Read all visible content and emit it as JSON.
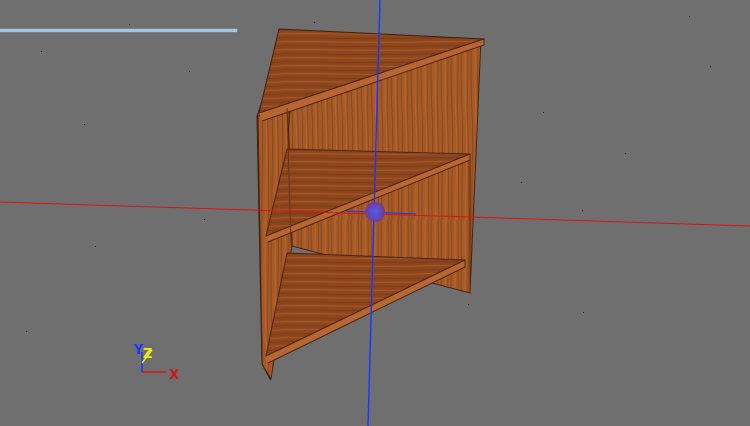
{
  "viewport": {
    "background": "#6f6f6f",
    "tool_strip_color": "#9fc7ea",
    "axis_colors": {
      "x": "#d91313",
      "y": "#1637ff",
      "z": "#e8e81b"
    }
  },
  "model": {
    "name": "",
    "wood_color": "#9b4f22",
    "shelf_count": 3
  },
  "triad": {
    "y_label": "Y",
    "z_label": "Z",
    "x_label": "X"
  }
}
